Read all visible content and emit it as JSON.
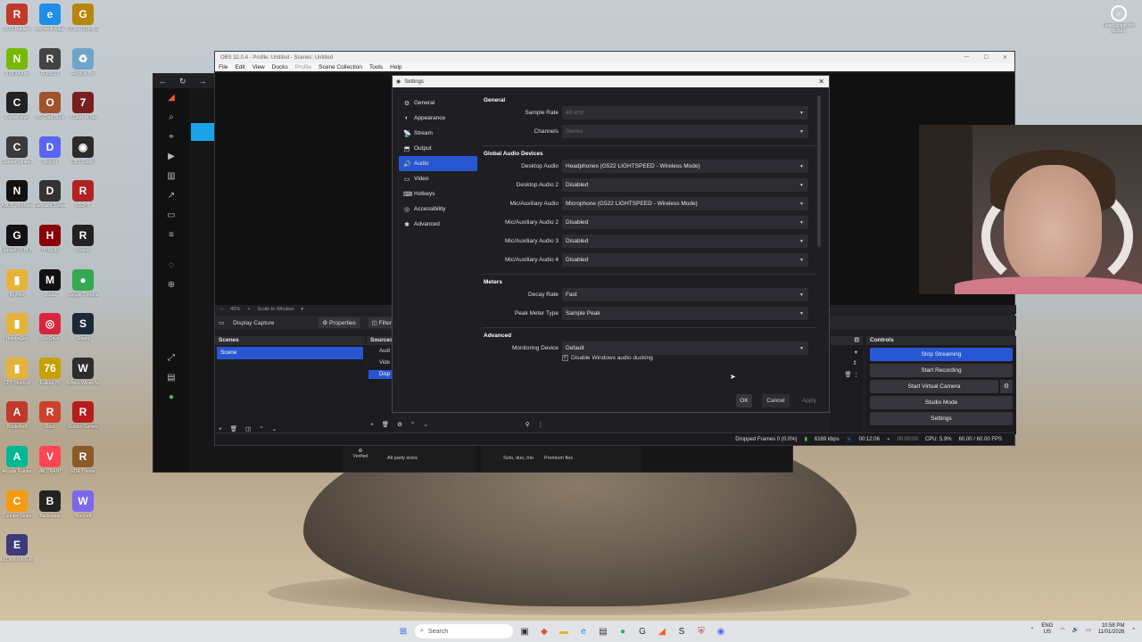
{
  "desktop": {
    "icons": [
      {
        "label": "ROG Raiders",
        "color": "#c0392b",
        "glyph": "R"
      },
      {
        "label": "Microsoft Edge",
        "color": "#1f8ee6",
        "glyph": "e"
      },
      {
        "label": "GONE FISHING",
        "color": "#b8860b",
        "glyph": "G"
      },
      {
        "label": "NVIDIA App",
        "color": "#76b900",
        "glyph": "N"
      },
      {
        "label": "ROBLOX",
        "color": "#444",
        "glyph": "R"
      },
      {
        "label": "Recycle Bin",
        "color": "#6fa5c9",
        "glyph": "♻"
      },
      {
        "label": "CurseForge",
        "color": "#222",
        "glyph": "C"
      },
      {
        "label": "OG Card Shop",
        "color": "#a0522d",
        "glyph": "O"
      },
      {
        "label": "7 Days to Die",
        "color": "#7a1f1f",
        "glyph": "7"
      },
      {
        "label": "Counter-Strike 2",
        "color": "#3a3a3a",
        "glyph": "C"
      },
      {
        "label": "Discord",
        "color": "#5865f2",
        "glyph": "D"
      },
      {
        "label": "OBS Studio",
        "color": "#2b2b2b",
        "glyph": "◉"
      },
      {
        "label": "ASUS Windows",
        "color": "#111",
        "glyph": "N"
      },
      {
        "label": "Dark and Darker",
        "color": "#333",
        "glyph": "D"
      },
      {
        "label": "RIGHT",
        "color": "#b22222",
        "glyph": "R"
      },
      {
        "label": "Logitech G HUB",
        "color": "#111",
        "glyph": "G"
      },
      {
        "label": "HYBRID",
        "color": "#8b0000",
        "glyph": "H"
      },
      {
        "label": "Rocket",
        "color": "#222",
        "glyph": "R"
      },
      {
        "label": "Bigfolio",
        "color": "#e5b33a",
        "glyph": "▮"
      },
      {
        "label": "Medal",
        "color": "#111",
        "glyph": "M"
      },
      {
        "label": "Google Chrome",
        "color": "#34a853",
        "glyph": "●"
      },
      {
        "label": "HoldenDev",
        "color": "#e5b33a",
        "glyph": "▮"
      },
      {
        "label": "OneDrive",
        "color": "#d7263d",
        "glyph": "◎"
      },
      {
        "label": "Steam",
        "color": "#1b2838",
        "glyph": "S"
      },
      {
        "label": "CPT Shortcut",
        "color": "#e5b33a",
        "glyph": "▮"
      },
      {
        "label": "Fallout 76",
        "color": "#c8a000",
        "glyph": "76"
      },
      {
        "label": "Where Winds Meet",
        "color": "#2d2d2d",
        "glyph": "W"
      },
      {
        "label": "Bookshelf",
        "color": "#c0392b",
        "glyph": "A"
      },
      {
        "label": "Rust",
        "color": "#ce422b",
        "glyph": "R"
      },
      {
        "label": "Roblox Games",
        "color": "#b71c1c",
        "glyph": "R"
      },
      {
        "label": "Arcade Painter",
        "color": "#00b894",
        "glyph": "A"
      },
      {
        "label": "VALORANT",
        "color": "#ff4655",
        "glyph": "V"
      },
      {
        "label": "RDR Theme",
        "color": "#8b5a2b",
        "glyph": "R"
      },
      {
        "label": "Counter-Strike",
        "color": "#f39c12",
        "glyph": "C"
      },
      {
        "label": "Backstage",
        "color": "#222",
        "glyph": "B"
      },
      {
        "label": "Warcraft",
        "color": "#7b68ee",
        "glyph": "W"
      },
      {
        "label": "ELDEN RING NIGHTREIGN",
        "color": "#3b3b7a",
        "glyph": "E"
      }
    ],
    "topright_label": "Learn about this picture"
  },
  "obs": {
    "window_title": "OBS 32.0.4 - Profile: Untitled - Scenes: Untitled",
    "menu": [
      "File",
      "Edit",
      "View",
      "Docks",
      "Profile",
      "Scene Collection",
      "Tools",
      "Help"
    ],
    "preview_bar": {
      "zoom": "45%",
      "mode": "Scale to Window"
    },
    "source_toolbar": {
      "source": "Display Capture",
      "properties": "Properties",
      "filters": "Filters"
    },
    "scenes_title": "Scenes",
    "scenes": [
      "Scene"
    ],
    "sources_title": "Sources",
    "sources": [
      "Audi",
      "Vide",
      "Disp"
    ],
    "controls_title": "Controls",
    "controls": [
      "Stop Streaming",
      "Start Recording",
      "Start Virtual Camera",
      "Studio Mode",
      "Settings"
    ],
    "status": {
      "dropped": "Dropped Frames 0 (0.0%)",
      "bitrate": "6169 kbps",
      "live_time": "00:12:06",
      "rec_time": "00:00:00",
      "cpu": "CPU: 5.9%",
      "fps": "60.00 / 60.00 FPS"
    }
  },
  "browser": {
    "tags": [
      "All party sizes",
      "Solo, duo, trio",
      "Premium flex"
    ],
    "verified": "Verified"
  },
  "settings": {
    "title": "Settings",
    "nav": [
      {
        "label": "General",
        "icon": "⚙"
      },
      {
        "label": "Appearance",
        "icon": "◐"
      },
      {
        "label": "Stream",
        "icon": "📡"
      },
      {
        "label": "Output",
        "icon": "⬒"
      },
      {
        "label": "Audio",
        "icon": "🔊"
      },
      {
        "label": "Video",
        "icon": "▭"
      },
      {
        "label": "Hotkeys",
        "icon": "⌨"
      },
      {
        "label": "Accessibility",
        "icon": "◎"
      },
      {
        "label": "Advanced",
        "icon": "✱"
      }
    ],
    "selected_nav": "Audio",
    "general": {
      "heading": "General",
      "sample_rate_label": "Sample Rate",
      "sample_rate": "48 kHz",
      "channels_label": "Channels",
      "channels": "Stereo"
    },
    "global_devices": {
      "heading": "Global Audio Devices",
      "rows": [
        {
          "label": "Desktop Audio",
          "value": "Headphones (G522 LIGHTSPEED - Wireless Mode)"
        },
        {
          "label": "Desktop Audio 2",
          "value": "Disabled"
        },
        {
          "label": "Mic/Auxiliary Audio",
          "value": "Microphone (G522 LIGHTSPEED - Wireless Mode)"
        },
        {
          "label": "Mic/Auxiliary Audio 2",
          "value": "Disabled"
        },
        {
          "label": "Mic/Auxiliary Audio 3",
          "value": "Disabled"
        },
        {
          "label": "Mic/Auxiliary Audio 4",
          "value": "Disabled"
        }
      ]
    },
    "meters": {
      "heading": "Meters",
      "decay_label": "Decay Rate",
      "decay": "Fast",
      "peak_label": "Peak Meter Type",
      "peak": "Sample Peak"
    },
    "advanced": {
      "heading": "Advanced",
      "monitoring_label": "Monitoring Device",
      "monitoring": "Default",
      "ducking_label": "Disable Windows audio ducking",
      "ducking_checked": true
    },
    "buttons": {
      "ok": "OK",
      "cancel": "Cancel",
      "apply": "Apply"
    }
  },
  "taskbar": {
    "search_placeholder": "Search",
    "lang": "ENG",
    "region": "US",
    "time": "10:58 PM",
    "date": "11/01/2026"
  }
}
